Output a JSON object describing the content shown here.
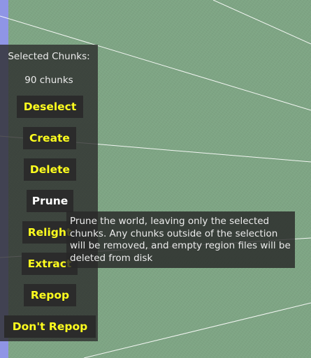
{
  "selection_panel": {
    "title": "Selected Chunks:",
    "count_label": "90 chunks",
    "buttons": [
      {
        "label": "Deselect",
        "color": "#ffff1e"
      },
      {
        "label": "Create",
        "color": "#ffff1e"
      },
      {
        "label": "Delete",
        "color": "#ffff1e"
      },
      {
        "label": "Prune",
        "color": "#ffffff"
      },
      {
        "label": "Relight",
        "color": "#ffff1e"
      },
      {
        "label": "Extract",
        "color": "#ffff1e"
      },
      {
        "label": "Repop",
        "color": "#ffff1e"
      },
      {
        "label": "Don't Repop",
        "color": "#ffff1e"
      }
    ]
  },
  "tooltip": {
    "text": "Prune the world, leaving only the selected chunks. Any chunks outside of the selection will be removed, and empty region files will be deleted from disk"
  }
}
